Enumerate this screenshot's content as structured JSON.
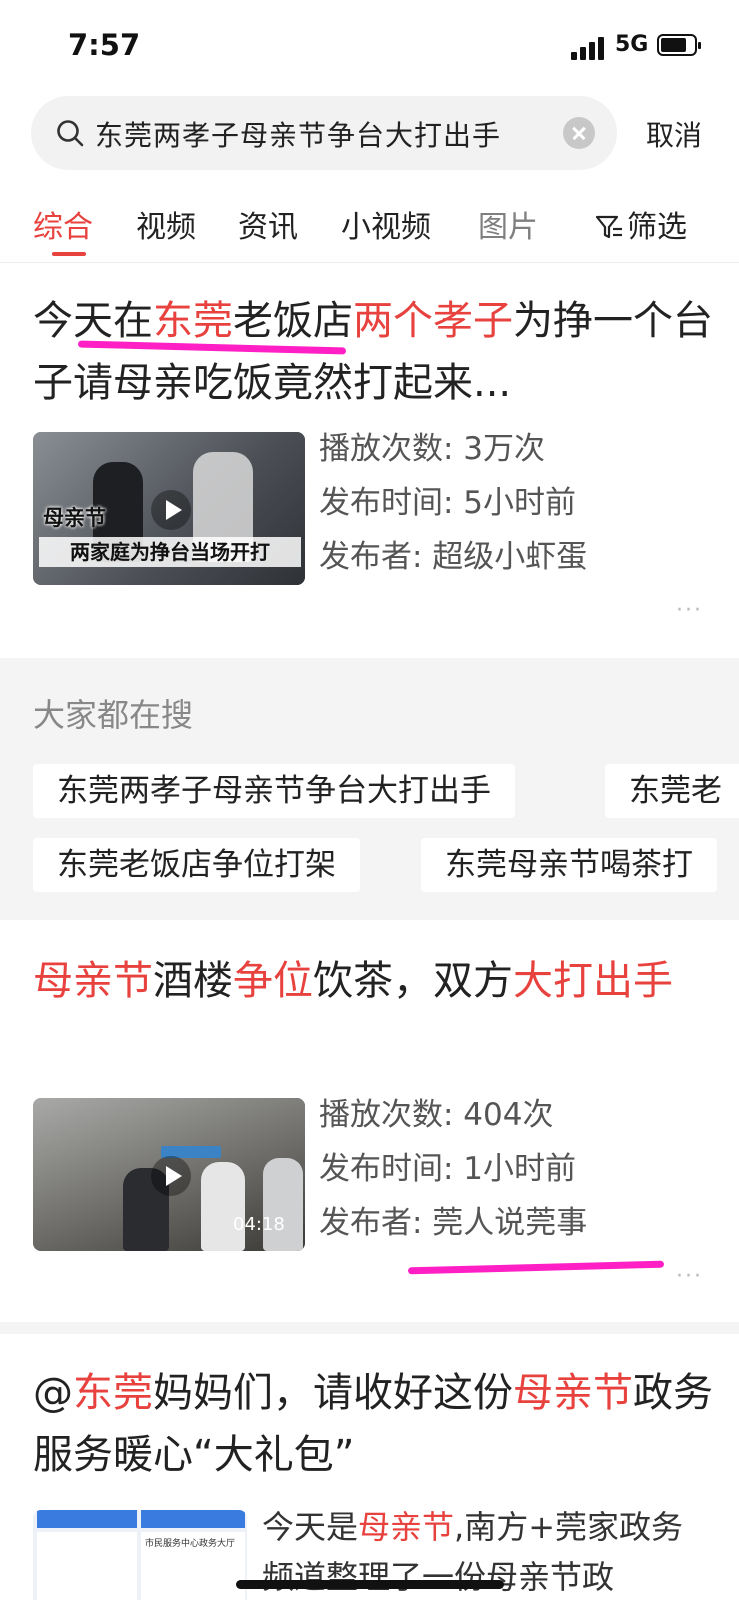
{
  "status": {
    "time": "7:57",
    "network": "5G"
  },
  "search": {
    "query": "东莞两孝子母亲节争台大打出手",
    "cancel": "取消"
  },
  "tabs": [
    "综合",
    "视频",
    "资讯",
    "小视频",
    "图片"
  ],
  "filter_label": "筛选",
  "colors": {
    "accent": "#e8423f",
    "annotation": "#ff1fc4"
  },
  "result1": {
    "title_parts": [
      "今天在",
      "东莞",
      "老饭店",
      "两个孝子",
      "为挣一个台子请母亲吃饭竟然打起来..."
    ],
    "thumb_caption_1": "母亲节",
    "thumb_caption_2": "两家庭为挣台当场开打",
    "plays": "播放次数: 3万次",
    "published": "发布时间: 5小时前",
    "publisher": "发布者: 超级小虾蛋",
    "more": "···"
  },
  "suggest": {
    "title": "大家都在搜",
    "chips": [
      "东莞两孝子母亲节争台大打出手",
      "东莞老",
      "东莞老饭店争位打架",
      "东莞母亲节喝茶打"
    ]
  },
  "result2": {
    "title_parts": [
      "母亲节",
      "酒楼",
      "争位",
      "饮茶，双方",
      "大打出手"
    ],
    "duration": "04:18",
    "plays": "播放次数: 404次",
    "published": "发布时间: 1小时前",
    "publisher": "发布者: 莞人说莞事",
    "more": "···"
  },
  "result3": {
    "title_parts": [
      "@",
      "东莞",
      "妈妈们，请收好这份",
      "母亲节",
      "政务服务暖心“大礼包”"
    ],
    "snippet_parts": [
      "今天是",
      "母亲节",
      ",南方+莞家政务频道整理了一份母亲节政"
    ],
    "thumb_heading": "市民服务中心政务大厅"
  }
}
